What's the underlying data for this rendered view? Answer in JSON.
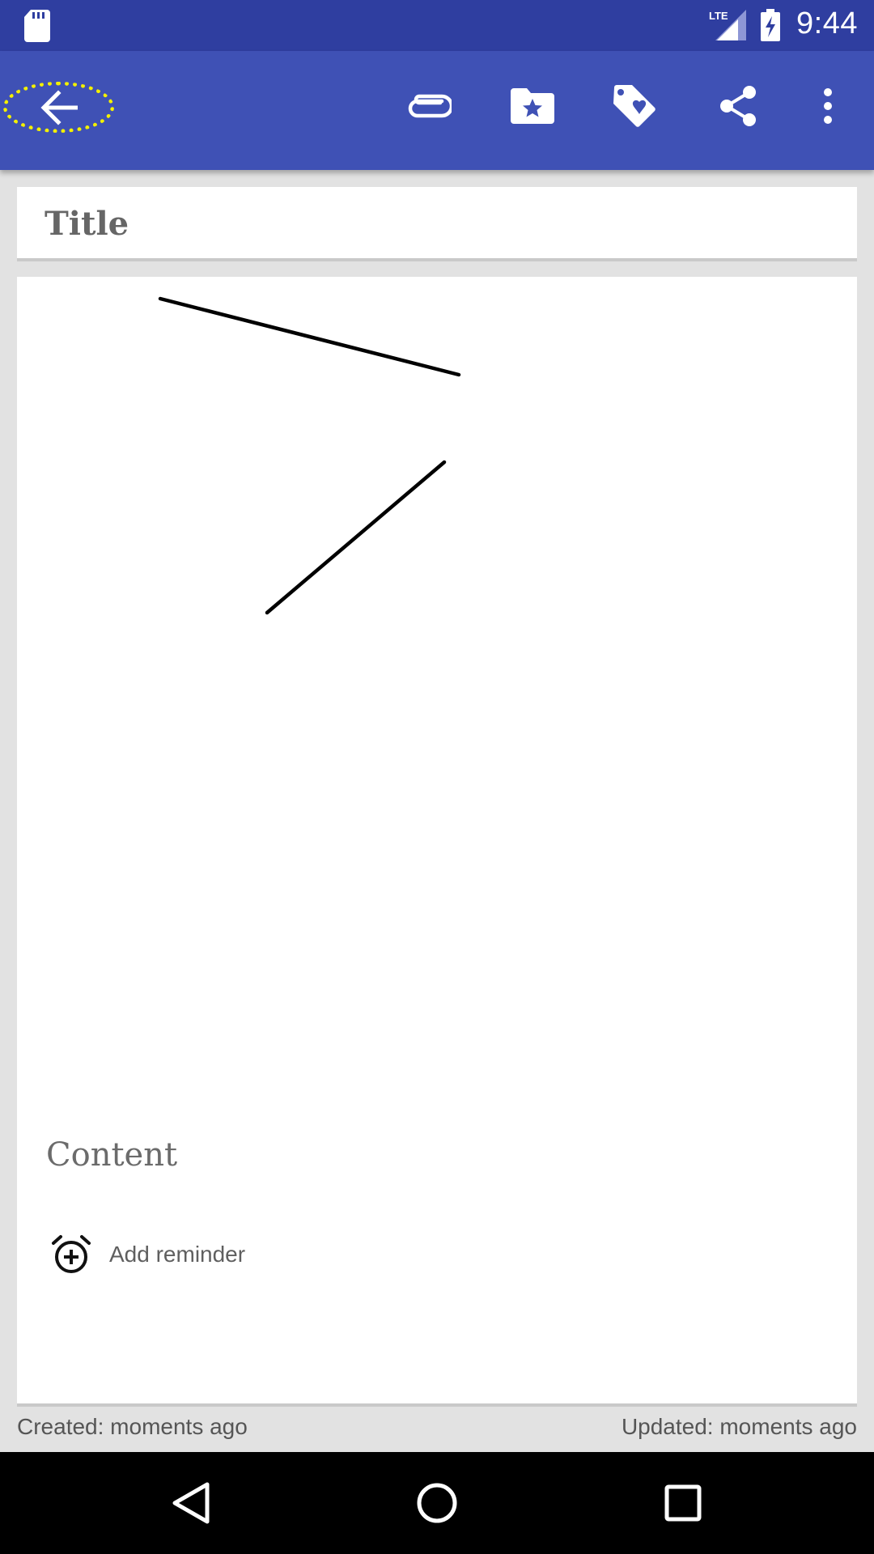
{
  "status_bar": {
    "time": "9:44",
    "network": "LTE",
    "icons": [
      "sd-card-icon",
      "signal-icon",
      "battery-charging-icon"
    ]
  },
  "toolbar": {
    "actions": [
      {
        "name": "back",
        "icon": "arrow-back-icon"
      },
      {
        "name": "attach",
        "icon": "paperclip-icon"
      },
      {
        "name": "category",
        "icon": "folder-star-icon"
      },
      {
        "name": "tag",
        "icon": "tag-heart-icon"
      },
      {
        "name": "share",
        "icon": "share-icon"
      },
      {
        "name": "more",
        "icon": "more-vert-icon"
      }
    ],
    "color": "#3f51b5",
    "status_color": "#2f3ea0",
    "focus_highlight_color": "#f3f000"
  },
  "note": {
    "title_placeholder": "Title",
    "content_placeholder": "Content",
    "reminder_label": "Add reminder",
    "reminder_icon": "alarm-add-icon"
  },
  "footer": {
    "created": "Created: moments ago",
    "updated": "Updated: moments ago"
  },
  "nav_bar": {
    "buttons": [
      "back-triangle-icon",
      "home-circle-icon",
      "recents-square-icon"
    ]
  }
}
